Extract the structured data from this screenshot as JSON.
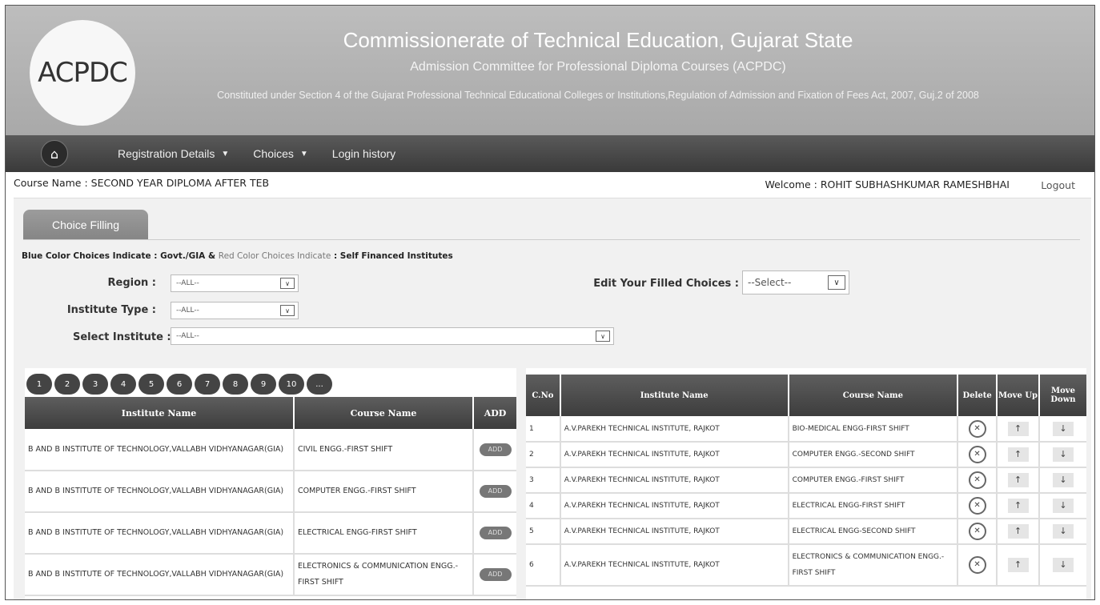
{
  "header": {
    "logo_text": "ACPDC",
    "title": "Commissionerate of Technical Education, Gujarat State",
    "subtitle": "Admission Committee for Professional Diploma Courses (ACPDC)",
    "description": "Constituted under Section 4 of the Gujarat Professional Technical Educational Colleges or Institutions,Regulation of Admission and Fixation of Fees Act, 2007, Guj.2 of 2008"
  },
  "nav": {
    "home_icon": "home-icon",
    "items": [
      {
        "label": "Registration Details",
        "has_caret": true
      },
      {
        "label": "Choices",
        "has_caret": true
      },
      {
        "label": "Login history",
        "has_caret": false
      }
    ]
  },
  "info": {
    "course_name": "Course Name : SECOND YEAR DIPLOMA AFTER TEB",
    "welcome": "Welcome : ROHIT SUBHASHKUMAR RAMESHBHAI",
    "logout": "Logout"
  },
  "tab": {
    "label": "Choice Filling"
  },
  "legend": {
    "part1": "Blue Color Choices Indicate : Govt./GIA &",
    "part2": "Red Color Choices Indicate",
    "part3": ": Self Financed Institutes"
  },
  "filters": {
    "region_label": "Region :",
    "region_value": "--ALL--",
    "type_label": "Institute Type :",
    "type_value": "--ALL--",
    "institute_label": "Select Institute :",
    "institute_value": "--ALL--",
    "edit_label": "Edit Your Filled Choices :",
    "edit_value": "--Select--"
  },
  "pager": [
    "1",
    "2",
    "3",
    "4",
    "5",
    "6",
    "7",
    "8",
    "9",
    "10",
    "..."
  ],
  "left_table": {
    "headers": [
      "Institute Name",
      "Course Name",
      "ADD"
    ],
    "add_label": "ADD",
    "rows": [
      {
        "institute": "B AND B INSTITUTE OF TECHNOLOGY,VALLABH VIDHYANAGAR(GIA)",
        "course": "CIVIL ENGG.-FIRST SHIFT"
      },
      {
        "institute": "B AND B INSTITUTE OF TECHNOLOGY,VALLABH VIDHYANAGAR(GIA)",
        "course": "COMPUTER ENGG.-FIRST SHIFT"
      },
      {
        "institute": "B AND B INSTITUTE OF TECHNOLOGY,VALLABH VIDHYANAGAR(GIA)",
        "course": "ELECTRICAL ENGG-FIRST SHIFT"
      },
      {
        "institute": "B AND B INSTITUTE OF TECHNOLOGY,VALLABH VIDHYANAGAR(GIA)",
        "course": "ELECTRONICS & COMMUNICATION ENGG.-FIRST SHIFT"
      }
    ]
  },
  "right_table": {
    "headers": [
      "C.No",
      "Institute Name",
      "Course Name",
      "Delete",
      "Move Up",
      "Move Down"
    ],
    "rows": [
      {
        "no": "1",
        "institute": "A.V.PAREKH TECHNICAL INSTITUTE, RAJKOT",
        "course": "BIO-MEDICAL ENGG-FIRST SHIFT"
      },
      {
        "no": "2",
        "institute": "A.V.PAREKH TECHNICAL INSTITUTE, RAJKOT",
        "course": "COMPUTER ENGG.-SECOND SHIFT"
      },
      {
        "no": "3",
        "institute": "A.V.PAREKH TECHNICAL INSTITUTE, RAJKOT",
        "course": "COMPUTER ENGG.-FIRST SHIFT"
      },
      {
        "no": "4",
        "institute": "A.V.PAREKH TECHNICAL INSTITUTE, RAJKOT",
        "course": "ELECTRICAL ENGG-FIRST SHIFT"
      },
      {
        "no": "5",
        "institute": "A.V.PAREKH TECHNICAL INSTITUTE, RAJKOT",
        "course": "ELECTRICAL ENGG-SECOND SHIFT"
      },
      {
        "no": "6",
        "institute": "A.V.PAREKH TECHNICAL INSTITUTE, RAJKOT",
        "course": "ELECTRONICS & COMMUNICATION ENGG.-FIRST SHIFT"
      }
    ]
  },
  "colors": {
    "header_bg": "#aaaaaa",
    "nav_bg": "#444444",
    "table_header_bg": "#4a4a4a"
  }
}
